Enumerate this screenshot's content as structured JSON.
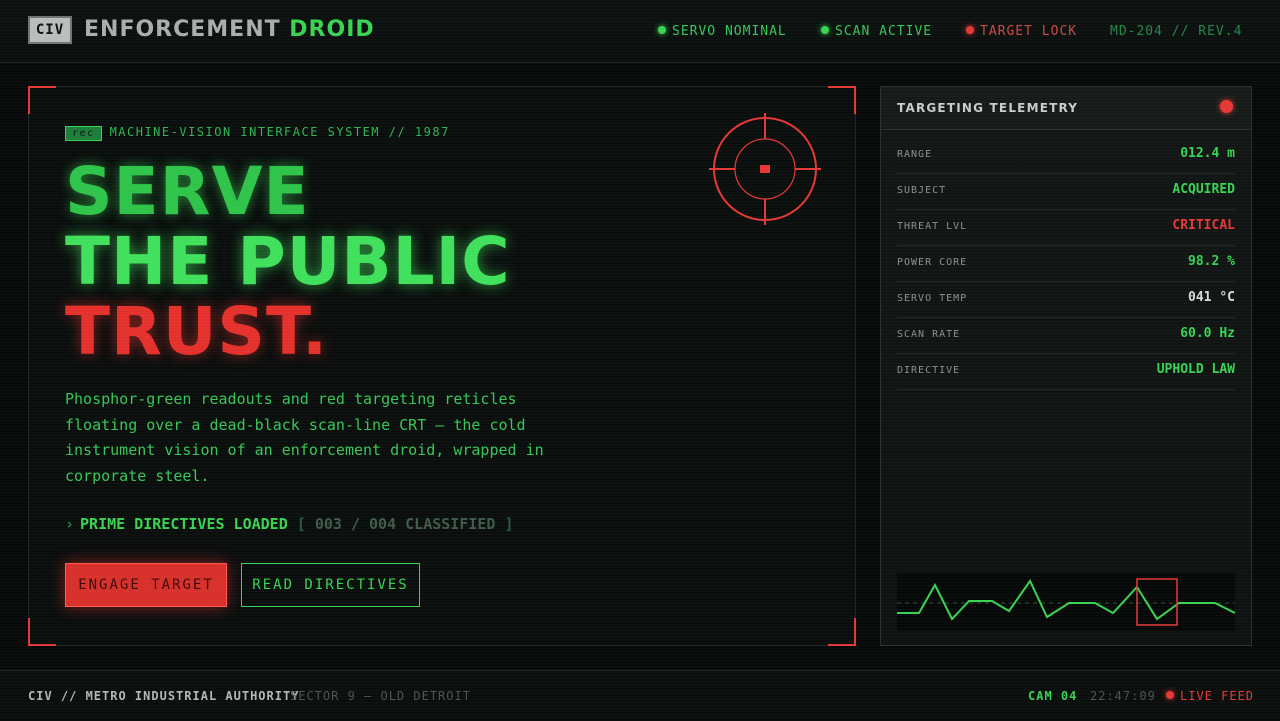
{
  "header": {
    "badge": "CIV",
    "title_main": "ENFORCEMENT",
    "title_accent": "DROID",
    "statuses": [
      {
        "label": "SERVO NOMINAL",
        "color": "#39d353"
      },
      {
        "label": "SCAN ACTIVE",
        "color": "#39d353"
      },
      {
        "label": "TARGET LOCK",
        "color": "#e53935"
      }
    ],
    "model": "MD-204 // REV.4"
  },
  "hero": {
    "rec_tag": "rec",
    "kicker": "MACHINE-VISION INTERFACE SYSTEM // 1987",
    "headline_1": "SERVE",
    "headline_2": "THE PUBLIC",
    "headline_3": "TRUST.",
    "body": "Phosphor-green readouts and red targeting reticles floating over a dead-black scan-line CRT — the cold instrument vision of an enforcement droid, wrapped in corporate steel.",
    "directive_chevron": "›",
    "directive_status": "PRIME DIRECTIVES LOADED",
    "directive_open": "[",
    "directive_count": "003 / 004 CLASSIFIED",
    "directive_close": "]",
    "engage_button": "ENGAGE TARGET",
    "read_button": "READ DIRECTIVES"
  },
  "telemetry": {
    "title": "TARGETING TELEMETRY",
    "rows": [
      {
        "label": "RANGE",
        "value": "012.4 m",
        "tone": "green"
      },
      {
        "label": "SUBJECT",
        "value": "ACQUIRED",
        "tone": "green"
      },
      {
        "label": "THREAT LVL",
        "value": "CRITICAL",
        "tone": "red"
      },
      {
        "label": "POWER CORE",
        "value": "98.2 %",
        "tone": "green"
      },
      {
        "label": "SERVO TEMP",
        "value": "041 °C",
        "tone": "white"
      },
      {
        "label": "SCAN RATE",
        "value": "60.0 Hz",
        "tone": "green"
      },
      {
        "label": "DIRECTIVE",
        "value": "UPHOLD LAW",
        "tone": "green"
      }
    ]
  },
  "footer": {
    "org": "CIV // METRO INDUSTRIAL AUTHORITY",
    "sector": "SECTOR 9 — OLD DETROIT",
    "cam": "CAM 04",
    "time": "22:47:09",
    "live": "LIVE FEED"
  },
  "colors": {
    "green": "#39d353",
    "red": "#e53935",
    "background": "#070a09"
  }
}
